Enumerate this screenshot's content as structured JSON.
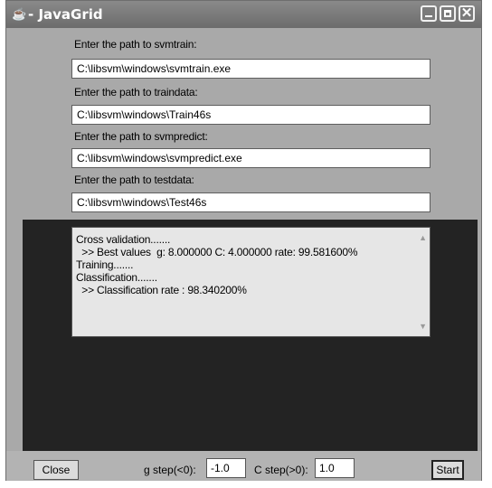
{
  "window": {
    "title": "- JavaGrid",
    "app_icon": "java-cup-icon"
  },
  "inputs": [
    {
      "label": "Enter the path to svmtrain:",
      "value": "C:\\libsvm\\windows\\svmtrain.exe"
    },
    {
      "label": "Enter the path to traindata:",
      "value": "C:\\libsvm\\windows\\Train46s"
    },
    {
      "label": "Enter the path to svmpredict:",
      "value": "C:\\libsvm\\windows\\svmpredict.exe"
    },
    {
      "label": "Enter the path to testdata:",
      "value": "C:\\libsvm\\windows\\Test46s"
    }
  ],
  "log": {
    "lines": [
      "Cross validation.......",
      "  >> Best values  g: 8.000000 C: 4.000000 rate: 99.581600%",
      "Training.......",
      "Classification.......",
      "  >> Classification rate : 98.340200%"
    ]
  },
  "bottom": {
    "close_label": "Close",
    "g_step_label": "g step(<0):",
    "g_step_value": "-1.0",
    "c_step_label": "C step(>0):",
    "c_step_value": "1.0",
    "start_label": "Start"
  }
}
